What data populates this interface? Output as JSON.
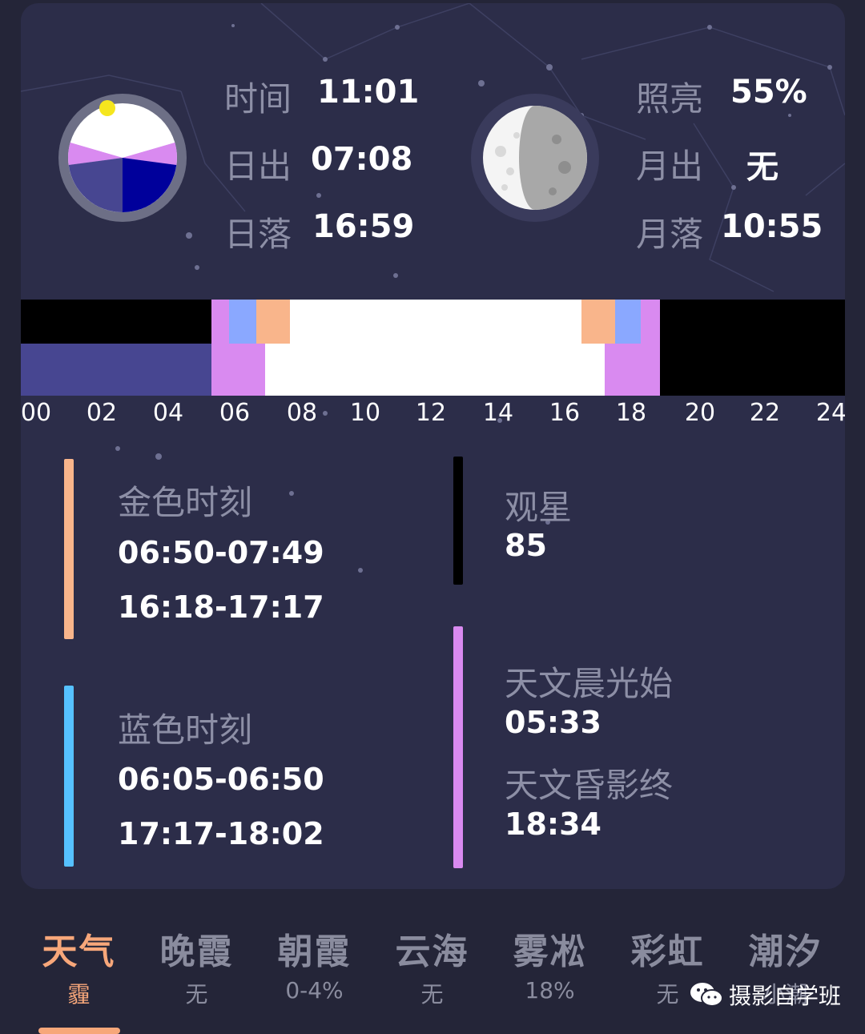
{
  "sun": {
    "time_label": "时间",
    "time_value": "11:01",
    "sunrise_label": "日出",
    "sunrise_value": "07:08",
    "sunset_label": "日落",
    "sunset_value": "16:59"
  },
  "moon": {
    "illumination_label": "照亮",
    "illumination_value": "55%",
    "moonrise_label": "月出",
    "moonrise_value": "无",
    "moonset_label": "月落",
    "moonset_value": "10:55"
  },
  "timeline": {
    "ticks": [
      "00",
      "02",
      "04",
      "06",
      "08",
      "10",
      "12",
      "14",
      "16",
      "18",
      "20",
      "22",
      "24"
    ],
    "current_time": "11:01"
  },
  "legend": {
    "golden_hour": {
      "title": "金色时刻",
      "morning": "06:50-07:49",
      "evening": "16:18-17:17",
      "color": "#f9b58b"
    },
    "blue_hour": {
      "title": "蓝色时刻",
      "morning": "06:05-06:50",
      "evening": "17:17-18:02",
      "color": "#56c1ff"
    },
    "stargazing": {
      "title": "观星",
      "value": "85",
      "color": "#000000"
    },
    "astronomical": {
      "dawn_title": "天文晨光始",
      "dawn_value": "05:33",
      "dusk_title": "天文昏影终",
      "dusk_value": "18:34",
      "color": "#d98af0"
    }
  },
  "tabs": [
    {
      "title": "天气",
      "sub": "霾",
      "active": true
    },
    {
      "title": "晚霞",
      "sub": "无"
    },
    {
      "title": "朝霞",
      "sub": "0-4%"
    },
    {
      "title": "云海",
      "sub": "无"
    },
    {
      "title": "雾凇",
      "sub": "18%"
    },
    {
      "title": "彩虹",
      "sub": "无"
    },
    {
      "title": "潮汐",
      "sub": "小潮"
    }
  ],
  "watermark": {
    "text": "摄影自学班",
    "icon": "wechat-icon"
  }
}
